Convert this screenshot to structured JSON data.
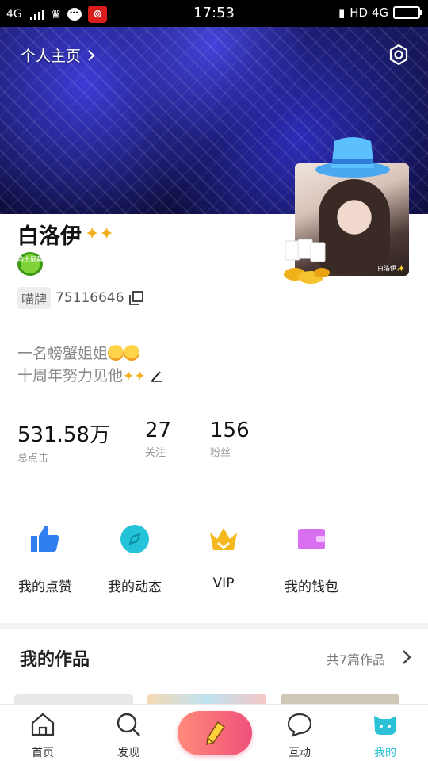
{
  "status_bar": {
    "network_left": "4G",
    "time": "17:53",
    "network_right": "HD 4G",
    "netease_glyph": "⊚"
  },
  "header": {
    "profile_link": "个人主页",
    "settings_icon": "settings-icon"
  },
  "profile": {
    "nickname": "白洛伊",
    "badge_text": "萌出屏幕",
    "id_tag": "喵牌",
    "id_number": "75116646",
    "bio_line1": "一名螃蟹姐姐",
    "bio_line2": "十周年努力见他",
    "avatar_tag": "白洛伊✨"
  },
  "stats": [
    {
      "value": "531.58万",
      "label": "总点击"
    },
    {
      "value": "27",
      "label": "关注"
    },
    {
      "value": "156",
      "label": "粉丝"
    }
  ],
  "functions": [
    {
      "label": "我的点赞",
      "icon": "thumbs-up-icon",
      "color": "#2f7ff0"
    },
    {
      "label": "我的动态",
      "icon": "compass-icon",
      "color": "#25c3d9"
    },
    {
      "label": "VIP",
      "icon": "crown-icon",
      "color": "#f5b91f"
    },
    {
      "label": "我的钱包",
      "icon": "wallet-icon",
      "color": "#d86ef0"
    }
  ],
  "works": {
    "title": "我的作品",
    "count": "共7篇作品"
  },
  "bottom_nav": [
    {
      "label": "首页",
      "icon": "home-icon"
    },
    {
      "label": "发现",
      "icon": "search-icon"
    },
    {
      "label": "",
      "icon": "pencil-icon"
    },
    {
      "label": "互动",
      "icon": "chat-icon"
    },
    {
      "label": "我的",
      "icon": "cat-face-icon"
    }
  ],
  "colors": {
    "accent": "#2cc0d4",
    "create_gradient_start": "#ff8a7a",
    "create_gradient_end": "#f0507b"
  }
}
